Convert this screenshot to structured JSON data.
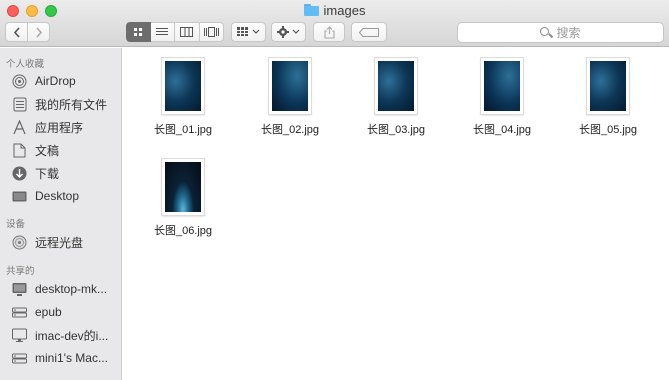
{
  "window": {
    "title": "images",
    "title_icon": "folder-icon"
  },
  "toolbar": {
    "back_icon": "chevron-left-icon",
    "forward_icon": "chevron-right-icon",
    "view_modes": [
      "icon-view-icon",
      "list-view-icon",
      "column-view-icon",
      "cover-flow-icon"
    ],
    "arrange_icon": "arrange-grid-icon",
    "action_icon": "gear-icon",
    "share_icon": "share-icon",
    "tags_icon": "tag-icon",
    "search_placeholder": "搜索"
  },
  "sidebar": {
    "favorites_header": "个人收藏",
    "favorites": [
      {
        "label": "AirDrop",
        "icon": "airdrop-icon"
      },
      {
        "label": "我的所有文件",
        "icon": "all-files-icon"
      },
      {
        "label": "应用程序",
        "icon": "applications-icon"
      },
      {
        "label": "文稿",
        "icon": "documents-icon"
      },
      {
        "label": "下载",
        "icon": "downloads-icon"
      },
      {
        "label": "Desktop",
        "icon": "desktop-icon"
      }
    ],
    "devices_header": "设备",
    "devices": [
      {
        "label": "远程光盘",
        "icon": "remote-disc-icon"
      }
    ],
    "shared_header": "共享的",
    "shared": [
      {
        "label": "desktop-mk...",
        "icon": "computer-icon"
      },
      {
        "label": "epub",
        "icon": "server-icon"
      },
      {
        "label": "imac-dev的i...",
        "icon": "imac-icon"
      },
      {
        "label": "mini1's Mac...",
        "icon": "server-icon"
      }
    ]
  },
  "files": [
    {
      "name": "长图_01.jpg"
    },
    {
      "name": "长图_02.jpg"
    },
    {
      "name": "长图_03.jpg"
    },
    {
      "name": "长图_04.jpg"
    },
    {
      "name": "长图_05.jpg"
    },
    {
      "name": "长图_06.jpg"
    }
  ]
}
